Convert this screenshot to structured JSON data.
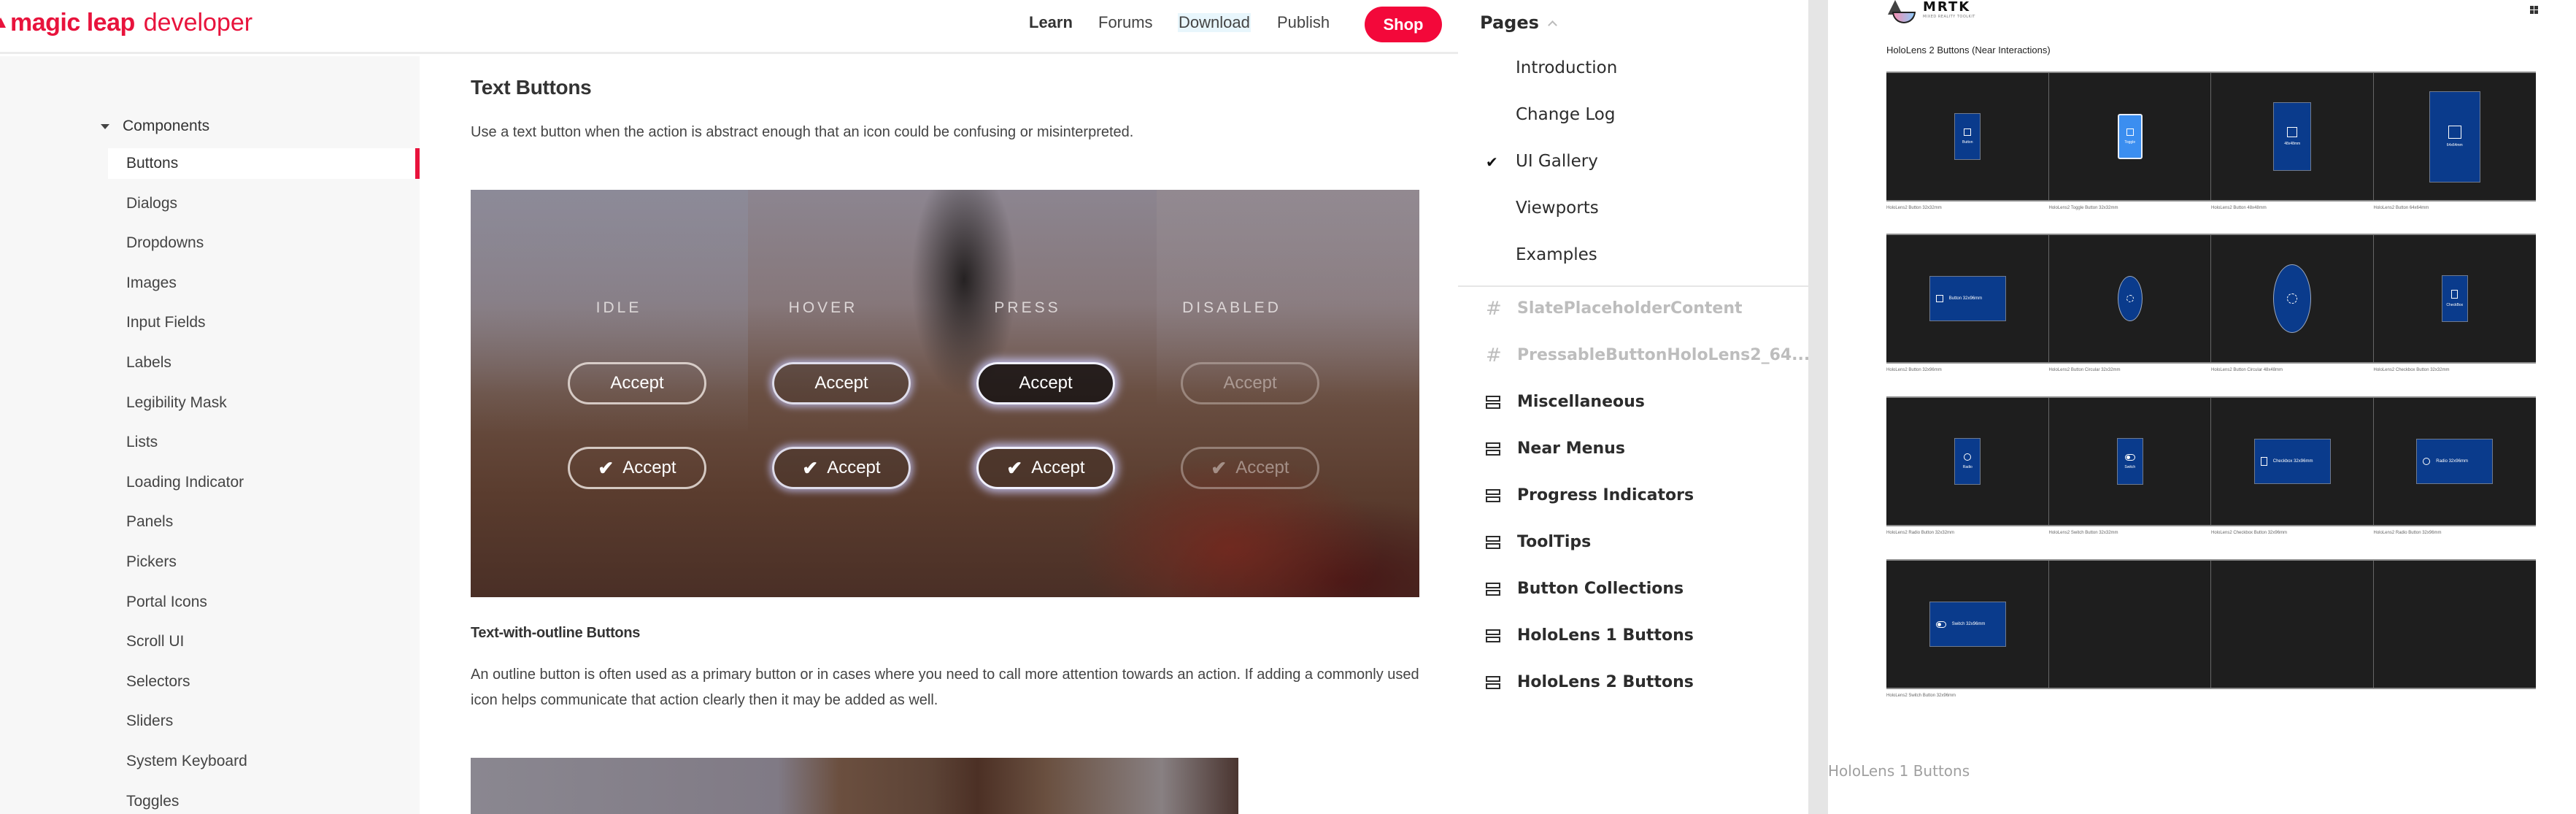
{
  "site": {
    "logo_bold": "magic leap",
    "logo_light": "developer",
    "nav": [
      {
        "label": "Learn",
        "style": "bold"
      },
      {
        "label": "Forums",
        "style": "normal"
      },
      {
        "label": "Download",
        "style": "highlight"
      },
      {
        "label": "Publish",
        "style": "normal"
      }
    ],
    "shop_label": "Shop",
    "brand_color": "#e8133c"
  },
  "sidebar": {
    "group_label": "Components",
    "items": [
      {
        "label": "Buttons",
        "active": true
      },
      {
        "label": "Dialogs"
      },
      {
        "label": "Dropdowns"
      },
      {
        "label": "Images"
      },
      {
        "label": "Input Fields"
      },
      {
        "label": "Labels"
      },
      {
        "label": "Legibility Mask"
      },
      {
        "label": "Lists"
      },
      {
        "label": "Loading Indicator"
      },
      {
        "label": "Panels"
      },
      {
        "label": "Pickers"
      },
      {
        "label": "Portal Icons"
      },
      {
        "label": "Scroll UI"
      },
      {
        "label": "Selectors"
      },
      {
        "label": "Sliders"
      },
      {
        "label": "System Keyboard"
      },
      {
        "label": "Toggles"
      }
    ]
  },
  "content": {
    "section1_title": "Text Buttons",
    "section1_text": "Use a text button when the action is abstract enough that an icon could be confusing or misinterpreted.",
    "demo": {
      "states": [
        "IDLE",
        "HOVER",
        "PRESS",
        "DISABLED"
      ],
      "button_label": "Accept",
      "check_glyph": "✔"
    },
    "section2_title": "Text-with-outline Buttons",
    "section2_text": "An outline button is often used as a primary button or in cases where you need to call more attention towards an action. If adding a commonly used icon helps communicate that action clearly then it may be added as well."
  },
  "pages_panel": {
    "title": "Pages",
    "pages": [
      {
        "label": "Introduction"
      },
      {
        "label": "Change Log"
      },
      {
        "label": "UI Gallery",
        "current": true
      },
      {
        "label": "Viewports"
      },
      {
        "label": "Examples"
      }
    ],
    "check_glyph": "✔",
    "frames": [
      {
        "label": "SlatePlaceholderContent",
        "icon": "frame-hash-icon",
        "faded": true
      },
      {
        "label": "PressableButtonHoloLens2_64...",
        "icon": "frame-hash-icon",
        "faded": true
      },
      {
        "label": "Miscellaneous",
        "icon": "section-stack-icon"
      },
      {
        "label": "Near Menus",
        "icon": "section-stack-icon"
      },
      {
        "label": "Progress Indicators",
        "icon": "section-stack-icon"
      },
      {
        "label": "ToolTips",
        "icon": "section-stack-icon"
      },
      {
        "label": "Button Collections",
        "icon": "section-stack-icon"
      },
      {
        "label": "HoloLens 1 Buttons",
        "icon": "section-stack-icon"
      },
      {
        "label": "HoloLens 2 Buttons",
        "icon": "section-stack-icon"
      }
    ],
    "hash_glyph": "#"
  },
  "canvas": {
    "mrtk_name": "MRTK",
    "mrtk_sub": "MIXED REALITY TOOLKIT",
    "title": "HoloLens 2 Buttons  (Near Interactions)",
    "rows": [
      {
        "cells": [
          {
            "kind": "square",
            "icon": "cube",
            "label": "Button",
            "caption": "HoloLens2 Button 32x32mm"
          },
          {
            "kind": "toggle",
            "icon": "cube",
            "label": "Toggle",
            "caption": "HoloLens2 Toggle Button 32x32mm"
          },
          {
            "kind": "square48",
            "icon": "cube",
            "label": "48x48mm",
            "caption": "HoloLens2 Button 48x48mm"
          },
          {
            "kind": "square64",
            "icon": "cube",
            "label": "64x64mm",
            "caption": "HoloLens2 Button 64x64mm"
          }
        ]
      },
      {
        "cells": [
          {
            "kind": "wide",
            "icon": "cube",
            "label": "Button 32x96mm",
            "caption": "HoloLens2 Button 32x96mm"
          },
          {
            "kind": "round32",
            "icon": "gear",
            "label": "",
            "caption": "HoloLens2 Button Circular 32x32mm"
          },
          {
            "kind": "round48",
            "icon": "gear",
            "label": "",
            "caption": "HoloLens2 Button Circular 48x48mm"
          },
          {
            "kind": "square",
            "icon": "box",
            "label": "CheckBox",
            "caption": "HoloLens2 Checkbox Button 32x32mm"
          }
        ]
      },
      {
        "cells": [
          {
            "kind": "square",
            "icon": "radio",
            "label": "Radio",
            "caption": "HoloLens2 Radio Button 32x32mm"
          },
          {
            "kind": "square",
            "icon": "switch",
            "label": "Switch",
            "caption": "HoloLens2 Switch Button 32x32mm"
          },
          {
            "kind": "wide",
            "icon": "box",
            "label": "Checkbox 32x96mm",
            "caption": "HoloLens2 Checkbox Button 32x96mm"
          },
          {
            "kind": "wide",
            "icon": "radio",
            "label": "Radio 32x96mm",
            "caption": "HoloLens2 Radio Button 32x96mm"
          }
        ]
      },
      {
        "cells": [
          {
            "kind": "wide",
            "icon": "switch",
            "label": "Switch 32x96mm",
            "caption": "HoloLens2 Switch Button 32x96mm"
          },
          {
            "kind": "empty"
          },
          {
            "kind": "empty"
          },
          {
            "kind": "empty"
          }
        ]
      }
    ],
    "next_frame_label": "HoloLens 1 Buttons",
    "button_color": "#0a3b8c",
    "toggle_color": "#3b8ef0"
  }
}
